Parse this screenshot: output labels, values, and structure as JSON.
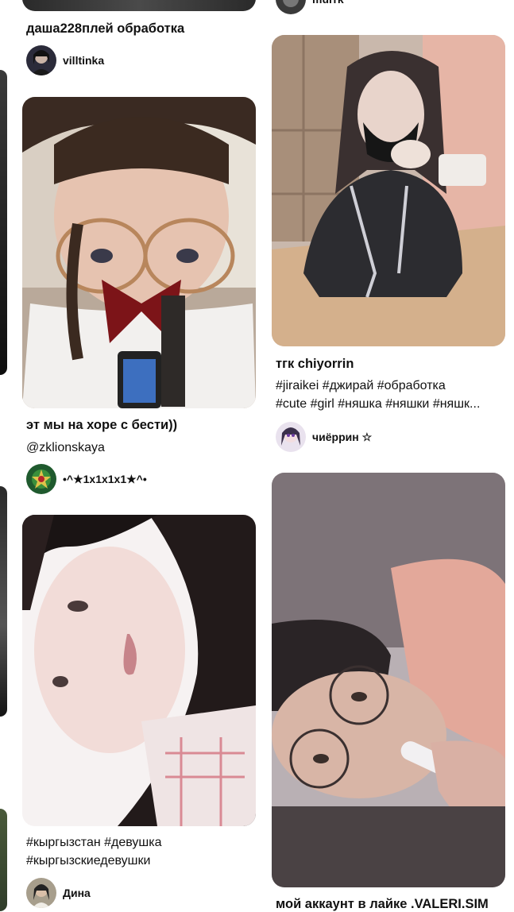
{
  "pins": [
    {
      "id": "p1",
      "title": "даша228плей обработка",
      "author": "villtinka"
    },
    {
      "id": "p2",
      "author": "murrk"
    },
    {
      "id": "p3",
      "title": "тгк chiyorrin",
      "description_line1": "#jiraikei #джирай #обработка",
      "description_line2": "#cute #girl #няшка #няшки #няшк...",
      "author": "чиёррин ☆"
    },
    {
      "id": "p4",
      "title": "эт мы на хоре с бести))",
      "subtitle": "@zklionskaya",
      "author": "•^★1x1x1x1★^•"
    },
    {
      "id": "p5",
      "description_line1": "#кыргызстан #девушка",
      "description_line2": "#кыргызскиедевушки",
      "author": "Дина"
    },
    {
      "id": "p6",
      "title": "мой аккаунт в лайке .VALERI.SIM"
    }
  ]
}
